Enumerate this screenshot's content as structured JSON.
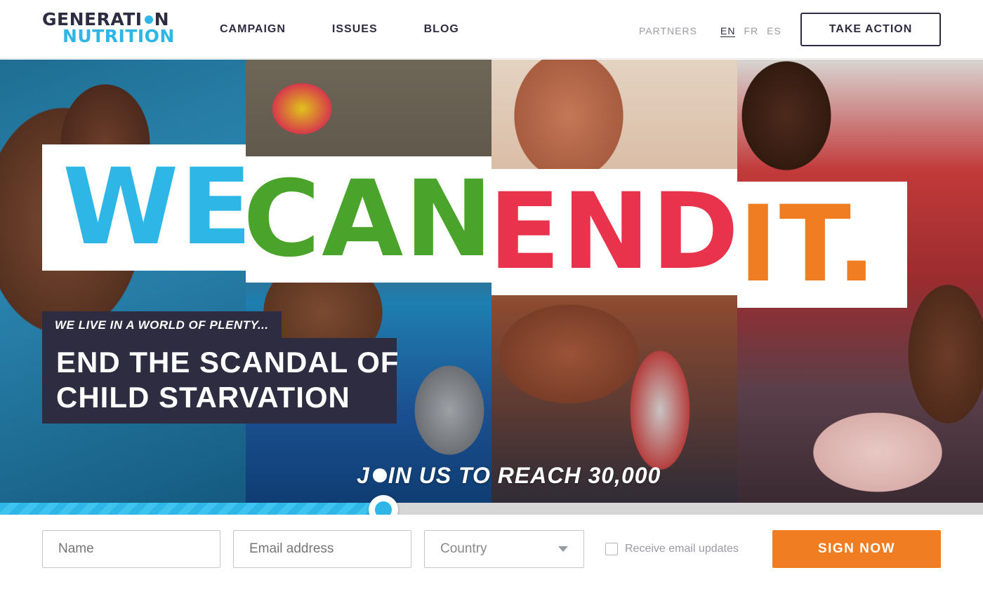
{
  "logo": {
    "line1_a": "GENERATI",
    "line1_b": "N",
    "line2": "NUTRITION"
  },
  "nav": {
    "items": [
      {
        "label": "CAMPAIGN"
      },
      {
        "label": "ISSUES"
      },
      {
        "label": "BLOG"
      }
    ]
  },
  "header": {
    "partners": "PARTNERS",
    "languages": [
      {
        "label": "EN",
        "active": true
      },
      {
        "label": "FR",
        "active": false
      },
      {
        "label": "ES",
        "active": false
      }
    ],
    "cta": "TAKE ACTION"
  },
  "hero": {
    "words": [
      "WE",
      "CAN",
      "END",
      "IT."
    ],
    "word_colors": [
      "#2db6e6",
      "#4aa32b",
      "#e9334d",
      "#f07d22"
    ],
    "kicker": "WE LIVE IN A WORLD OF PLENTY...",
    "headline_line1": "END THE SCANDAL OF",
    "headline_line2": "CHILD STARVATION",
    "join_a": "J",
    "join_b": "IN US TO REACH 30,000",
    "progress_fraction": 0.39
  },
  "form": {
    "name_placeholder": "Name",
    "email_placeholder": "Email address",
    "country_selected": "Country",
    "checkbox_label": "Receive email updates",
    "submit": "SIGN NOW"
  },
  "colors": {
    "brand_dark": "#2d2c41",
    "brand_blue": "#2db6e6",
    "accent_orange": "#f07d22"
  }
}
